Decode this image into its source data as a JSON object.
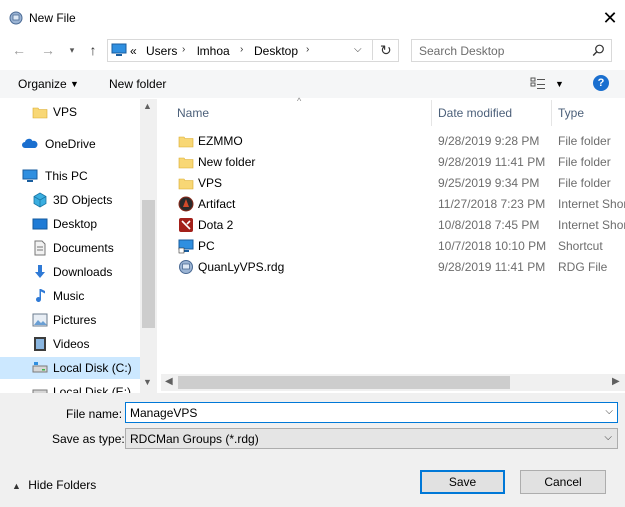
{
  "window": {
    "title": "New File"
  },
  "nav": {
    "breadcrumb": [
      "«",
      "Users",
      "lmhoa",
      "Desktop"
    ],
    "search_placeholder": "Search Desktop"
  },
  "toolbar": {
    "organize": "Organize",
    "new_folder": "New folder"
  },
  "sidebar": {
    "items": [
      {
        "label": "VPS",
        "icon": "folder-icon"
      },
      {
        "label": "OneDrive",
        "icon": "cloud-icon"
      },
      {
        "label": "This PC",
        "icon": "computer-icon"
      },
      {
        "label": "3D Objects",
        "icon": "cube-icon"
      },
      {
        "label": "Desktop",
        "icon": "desktop-icon"
      },
      {
        "label": "Documents",
        "icon": "document-icon"
      },
      {
        "label": "Downloads",
        "icon": "download-icon"
      },
      {
        "label": "Music",
        "icon": "music-icon"
      },
      {
        "label": "Pictures",
        "icon": "picture-icon"
      },
      {
        "label": "Videos",
        "icon": "video-icon"
      },
      {
        "label": "Local Disk (C:)",
        "icon": "disk-icon"
      },
      {
        "label": "Local Disk (E:)",
        "icon": "disk-icon"
      }
    ]
  },
  "columns": {
    "name": "Name",
    "date": "Date modified",
    "type": "Type"
  },
  "files": [
    {
      "name": "EZMMO",
      "date": "9/28/2019 9:28 PM",
      "type": "File folder",
      "icon": "folder-icon"
    },
    {
      "name": "New folder",
      "date": "9/28/2019 11:41 PM",
      "type": "File folder",
      "icon": "folder-icon"
    },
    {
      "name": "VPS",
      "date": "9/25/2019 9:34 PM",
      "type": "File folder",
      "icon": "folder-icon"
    },
    {
      "name": "Artifact",
      "date": "11/27/2018 7:23 PM",
      "type": "Internet Shor",
      "icon": "artifact-icon"
    },
    {
      "name": "Dota 2",
      "date": "10/8/2018 7:45 PM",
      "type": "Internet Shor",
      "icon": "dota-icon"
    },
    {
      "name": "PC",
      "date": "10/7/2018 10:10 PM",
      "type": "Shortcut",
      "icon": "pc-shortcut-icon"
    },
    {
      "name": "QuanLyVPS.rdg",
      "date": "9/28/2019 11:41 PM",
      "type": "RDG File",
      "icon": "rdg-file-icon"
    }
  ],
  "form": {
    "file_name_label": "File name:",
    "file_name_value": "ManageVPS",
    "save_type_label": "Save as type:",
    "save_type_value": "RDCMan Groups (*.rdg)"
  },
  "buttons": {
    "save": "Save",
    "cancel": "Cancel",
    "hide_folders": "Hide Folders"
  },
  "colors": {
    "accent": "#0078d7",
    "selected": "#cce8ff",
    "folder": "#f8d775"
  }
}
